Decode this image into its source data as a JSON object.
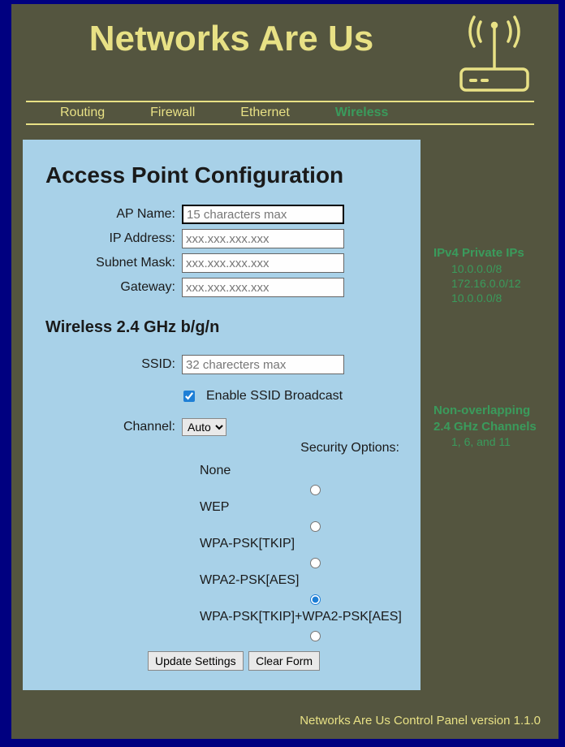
{
  "header": {
    "title": "Networks Are Us"
  },
  "nav": {
    "items": [
      {
        "label": "Routing",
        "active": false
      },
      {
        "label": "Firewall",
        "active": false
      },
      {
        "label": "Ethernet",
        "active": false
      },
      {
        "label": "Wireless",
        "active": true
      }
    ]
  },
  "panel": {
    "title": "Access Point Configuration",
    "fields": {
      "ap_name": {
        "label": "AP Name:",
        "placeholder": "15 characters max",
        "value": ""
      },
      "ip_address": {
        "label": "IP Address:",
        "placeholder": "xxx.xxx.xxx.xxx",
        "value": ""
      },
      "subnet_mask": {
        "label": "Subnet Mask:",
        "placeholder": "xxx.xxx.xxx.xxx",
        "value": ""
      },
      "gateway": {
        "label": "Gateway:",
        "placeholder": "xxx.xxx.xxx.xxx",
        "value": ""
      }
    },
    "wireless_section": {
      "title": "Wireless 2.4 GHz b/g/n",
      "ssid": {
        "label": "SSID:",
        "placeholder": "32 charecters max",
        "value": ""
      },
      "broadcast": {
        "label": "Enable SSID Broadcast",
        "checked": true
      },
      "channel": {
        "label": "Channel:",
        "selected": "Auto"
      },
      "security": {
        "header": "Security Options:",
        "options": [
          {
            "label": "None",
            "selected": false
          },
          {
            "label": "WEP",
            "selected": false
          },
          {
            "label": "WPA-PSK[TKIP]",
            "selected": false
          },
          {
            "label": "WPA2-PSK[AES]",
            "selected": true
          },
          {
            "label": "WPA-PSK[TKIP]+WPA2-PSK[AES]",
            "selected": false
          }
        ]
      }
    },
    "buttons": {
      "update": "Update Settings",
      "clear": "Clear Form"
    }
  },
  "sidebar": {
    "block1": {
      "title": "IPv4 Private IPs",
      "lines": [
        "10.0.0.0/8",
        "172.16.0.0/12",
        "10.0.0.0/8"
      ]
    },
    "block2": {
      "title1": "Non-overlapping",
      "title2": "2.4 GHz Channels",
      "lines": [
        "1, 6, and 11"
      ]
    }
  },
  "footer": "Networks Are Us Control Panel version 1.1.0"
}
